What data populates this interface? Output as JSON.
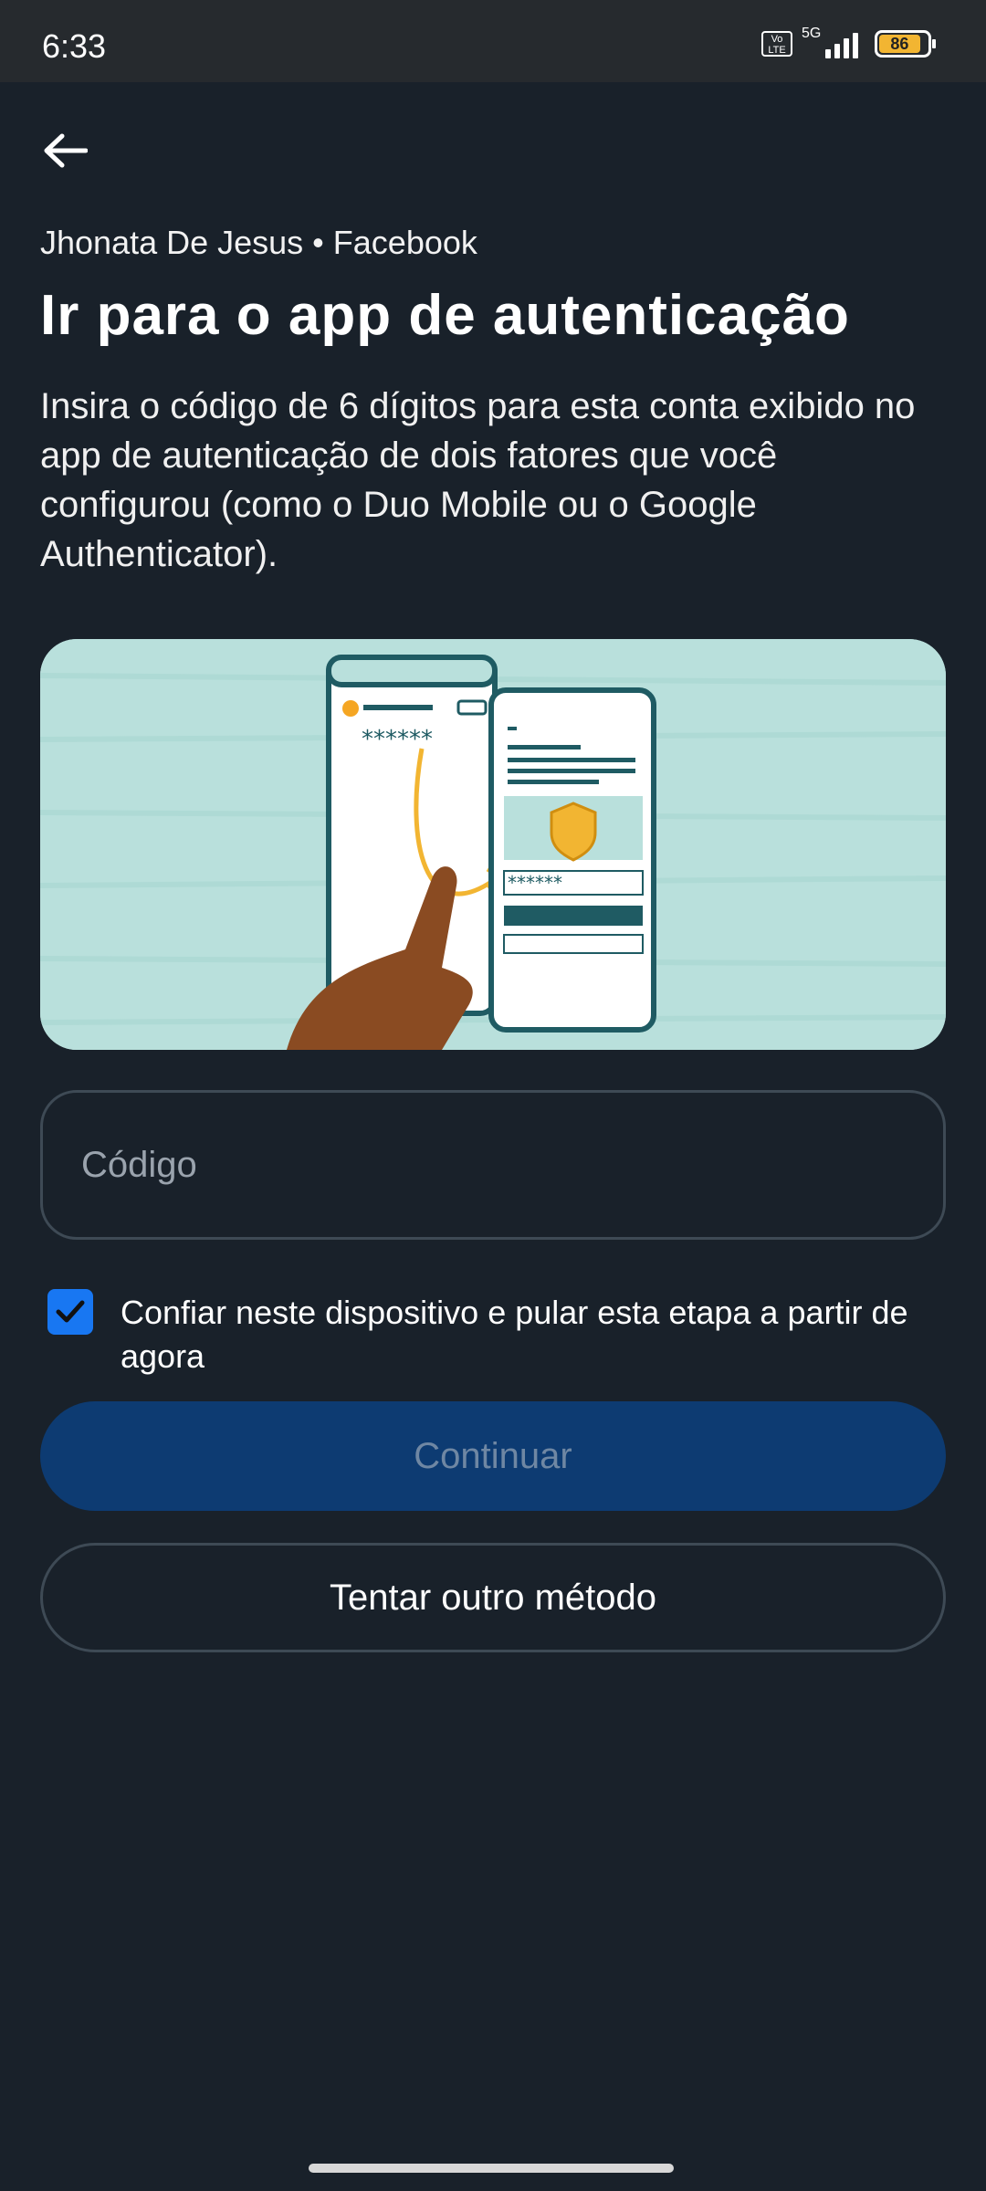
{
  "status_bar": {
    "time": "6:33",
    "network": "5G",
    "volte": "Vo LTE",
    "battery_level": "86"
  },
  "header": {
    "back_icon": "arrow-left-icon",
    "account": "Jhonata De Jesus • Facebook",
    "title": "Ir para o app de autenticação",
    "description": "Insira o código de 6 dígitos para esta conta exibido no app de autenticação de dois fatores que você configurou (como o Duo Mobile ou o Google Authenticator)."
  },
  "illustration": {
    "icon": "authenticator-illustration",
    "code_mask": "******"
  },
  "form": {
    "code_placeholder": "Código",
    "code_value": "",
    "trust_device_checked": true,
    "trust_device_label": "Confiar neste dispositivo e pular esta etapa a partir de agora"
  },
  "buttons": {
    "continue_label": "Continuar",
    "other_method_label": "Tentar outro método"
  },
  "colors": {
    "background": "#19212a",
    "primary_button": "#0d3b72",
    "checkbox": "#1877f2",
    "border": "#3e4a55"
  }
}
